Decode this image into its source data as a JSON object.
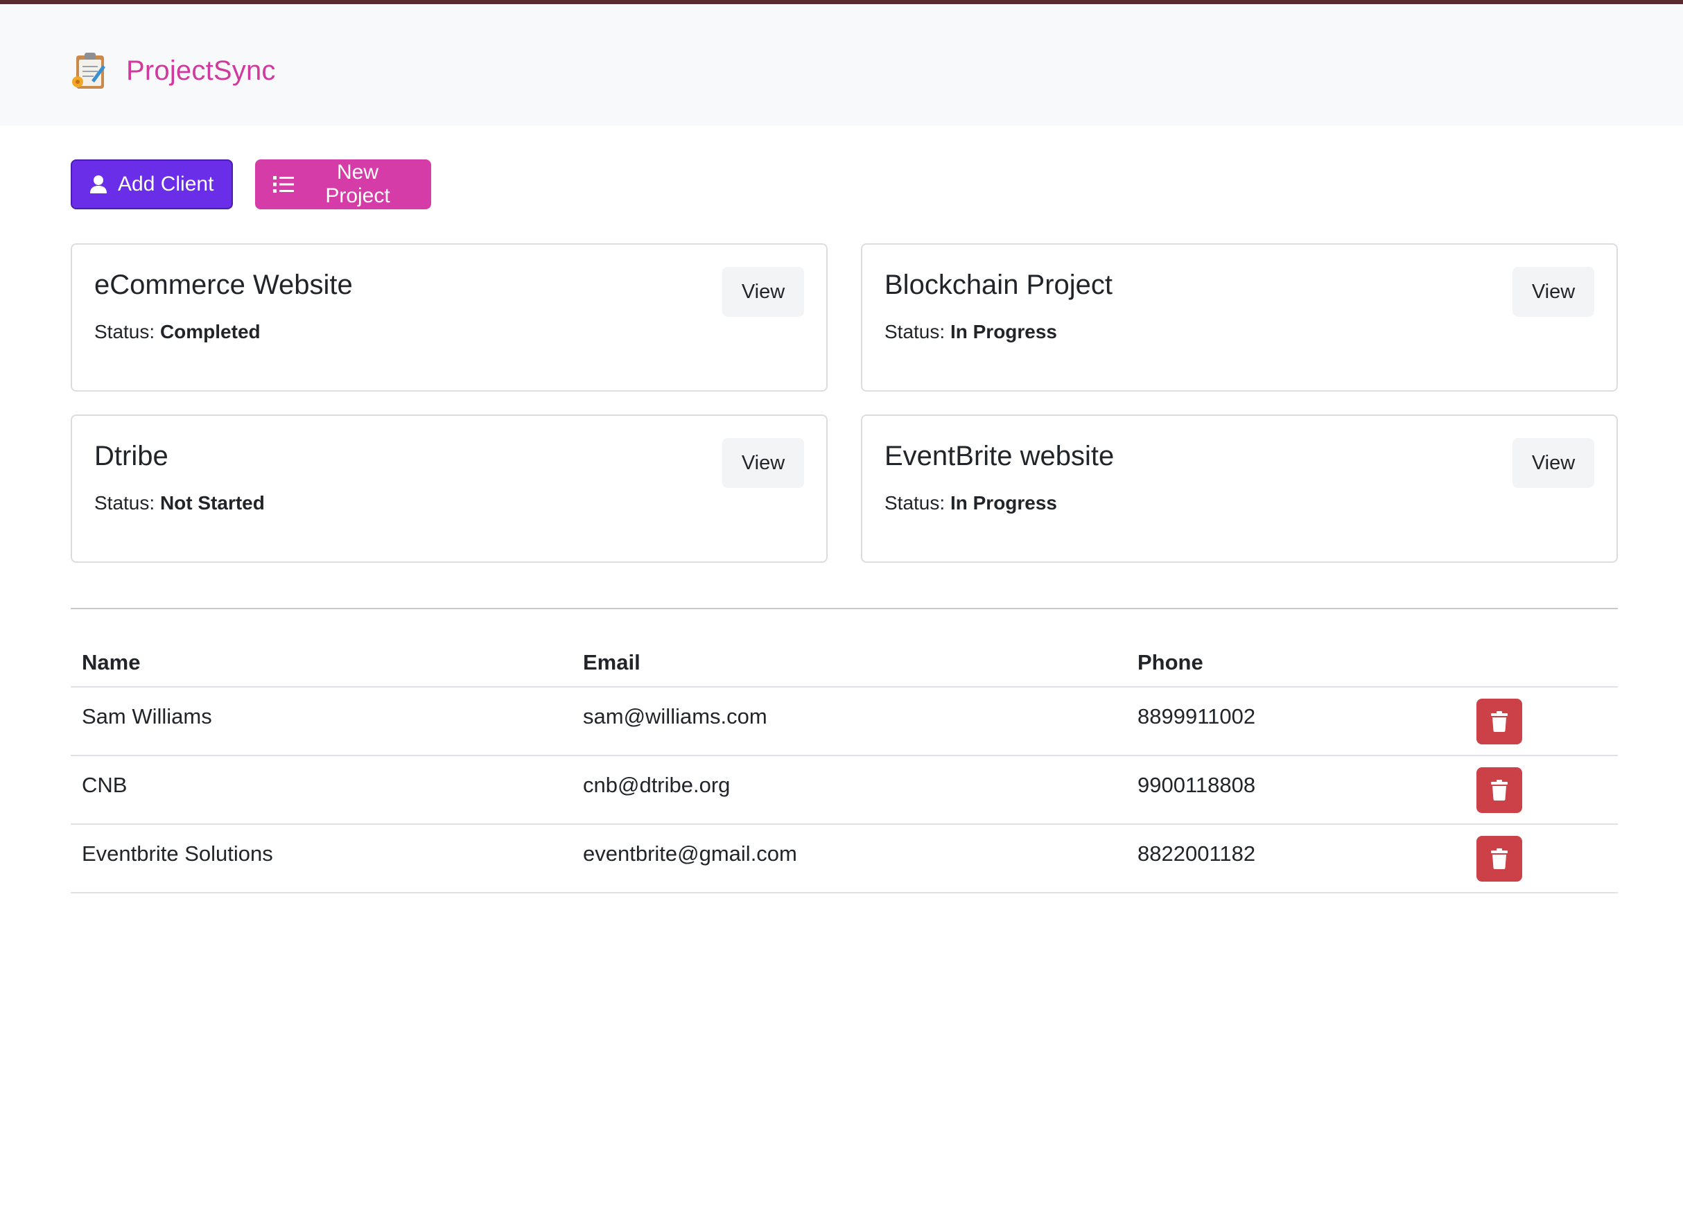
{
  "app": {
    "name": "ProjectSync"
  },
  "colors": {
    "brand": "#d03a9f",
    "add_client": "#6a2ee8",
    "new_project": "#d63ca8",
    "delete": "#cc4148"
  },
  "actions": {
    "add_client_label": "Add Client",
    "add_client_icon": "user-icon",
    "new_project_label": "New Project",
    "new_project_icon": "list-icon"
  },
  "projects": [
    {
      "name": "eCommerce Website",
      "status_label": "Status:",
      "status": "Completed",
      "view_label": "View"
    },
    {
      "name": "Blockchain Project",
      "status_label": "Status:",
      "status": "In Progress",
      "view_label": "View"
    },
    {
      "name": "Dtribe",
      "status_label": "Status:",
      "status": "Not Started",
      "view_label": "View"
    },
    {
      "name": "EventBrite website",
      "status_label": "Status:",
      "status": "In Progress",
      "view_label": "View"
    }
  ],
  "clients": {
    "headers": [
      "Name",
      "Email",
      "Phone"
    ],
    "rows": [
      {
        "name": "Sam Williams",
        "email": "sam@williams.com",
        "phone": "8899911002",
        "delete_icon": "trash-icon"
      },
      {
        "name": "CNB",
        "email": "cnb@dtribe.org",
        "phone": "9900118808",
        "delete_icon": "trash-icon"
      },
      {
        "name": "Eventbrite Solutions",
        "email": "eventbrite@gmail.com",
        "phone": "8822001182",
        "delete_icon": "trash-icon"
      }
    ]
  }
}
